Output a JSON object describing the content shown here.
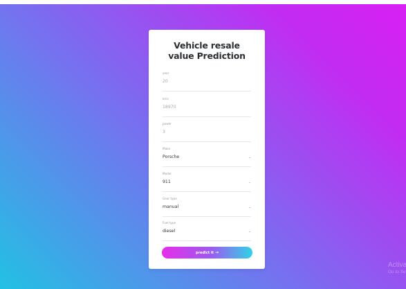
{
  "form": {
    "title_line1": "Vehicle resale",
    "title_line2": "value Prediction",
    "fields": [
      {
        "label": "year",
        "value": "20"
      },
      {
        "label": "kms",
        "value": "18970"
      },
      {
        "label": "power",
        "value": "3"
      },
      {
        "label": "Make",
        "value": "Porsche"
      },
      {
        "label": "Model",
        "value": "911"
      },
      {
        "label": "Gear type",
        "value": "manual"
      },
      {
        "label": "Fuel type",
        "value": "diesel"
      }
    ],
    "predict_label": "predict it",
    "chevron_glyph": "⌄",
    "arrow_glyph": "→"
  },
  "watermark": {
    "line1": "Activate Windows",
    "line2": "Go to Settings to activate Windows."
  },
  "colors": {
    "bg_start": "#22c1e3",
    "bg_end": "#d91ff4",
    "button_start": "#e62ee8",
    "button_end": "#2fd4e6"
  },
  "icons": {
    "select_chevron": "chevron-down-icon",
    "predict_arrow": "arrow-right-icon"
  }
}
